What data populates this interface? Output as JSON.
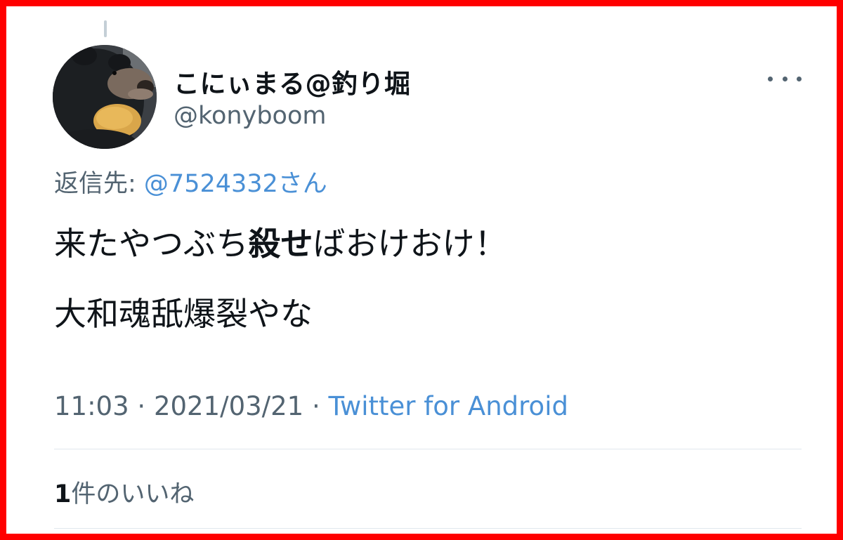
{
  "tweet": {
    "author": {
      "display_name": "こにぃまる@釣り堀",
      "handle": "@konyboom",
      "avatar_icon": "black-bear-avatar-icon"
    },
    "more_icon": "more-horizontal-icon",
    "reply_to": {
      "prefix": "返信先: ",
      "mention": "@7524332さん"
    },
    "text": {
      "line1_part1": "来たやつぶち",
      "line1_bold": "殺せ",
      "line1_part2": "ばおけおけ！",
      "line2": "大和魂舐爆裂やな"
    },
    "meta": {
      "time": "11:03",
      "separator1": " · ",
      "date": "2021/03/21",
      "separator2": " · ",
      "source": "Twitter for Android"
    },
    "likes": {
      "count": "1",
      "label": "件のいいね"
    }
  },
  "colors": {
    "frame_border": "#ff0000",
    "link": "#4a90d6",
    "secondary_text": "#536471",
    "primary_text": "#0f1419"
  }
}
